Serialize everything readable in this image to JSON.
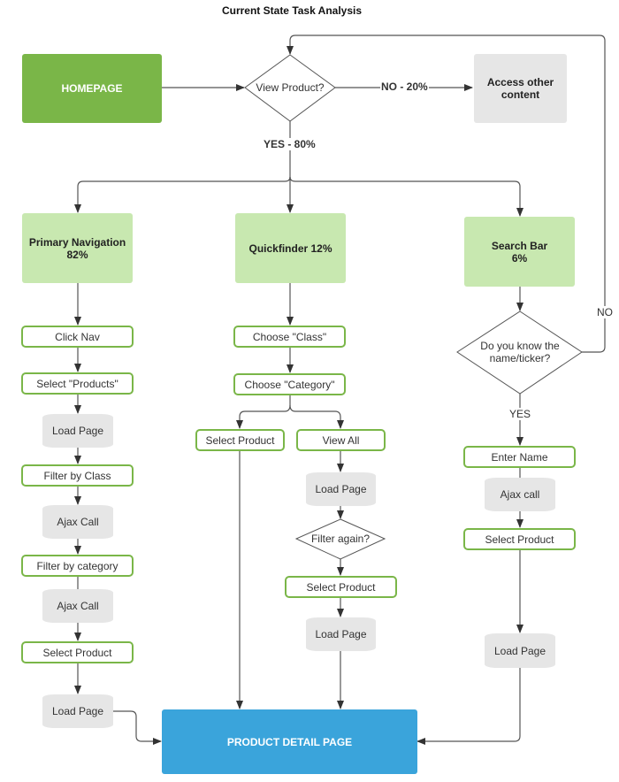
{
  "title": "Current State Task Analysis",
  "colors": {
    "homepage": "#7ab648",
    "product_detail": "#3aa4db",
    "channel": "#c8e8b0",
    "step_border": "#7ab648",
    "system": "#e6e6e6",
    "connector": "#444444"
  },
  "nodes": {
    "homepage": "HOMEPAGE",
    "view_product": "View Product?",
    "access_other": "Access other\ncontent",
    "primary_nav": "Primary Navigation\n82%",
    "quickfinder": "Quickfinder 12%",
    "search_bar": "Search Bar\n6%",
    "product_detail": "PRODUCT DETAIL PAGE",
    "nav_steps": [
      "Click Nav",
      "Select \"Products\"",
      "Load Page",
      "Filter by Class",
      "Ajax Call",
      "Filter by category",
      "Ajax Call",
      "Select Product",
      "Load Page"
    ],
    "qf_steps": [
      "Choose \"Class\"",
      "Choose \"Category\""
    ],
    "qf_select_product": "Select Product",
    "qf_view_all": "View All",
    "qf_view_all_steps": [
      "Load Page",
      "Filter again?",
      "Select Product",
      "Load Page"
    ],
    "search_decision": "Do you know the\nname/ticker?",
    "search_steps": [
      "Enter Name",
      "Ajax call",
      "Select Product",
      "Load Page"
    ]
  },
  "edge_labels": {
    "no_20": "NO - 20%",
    "yes_80": "YES - 80%",
    "no": "NO",
    "yes": "YES"
  }
}
